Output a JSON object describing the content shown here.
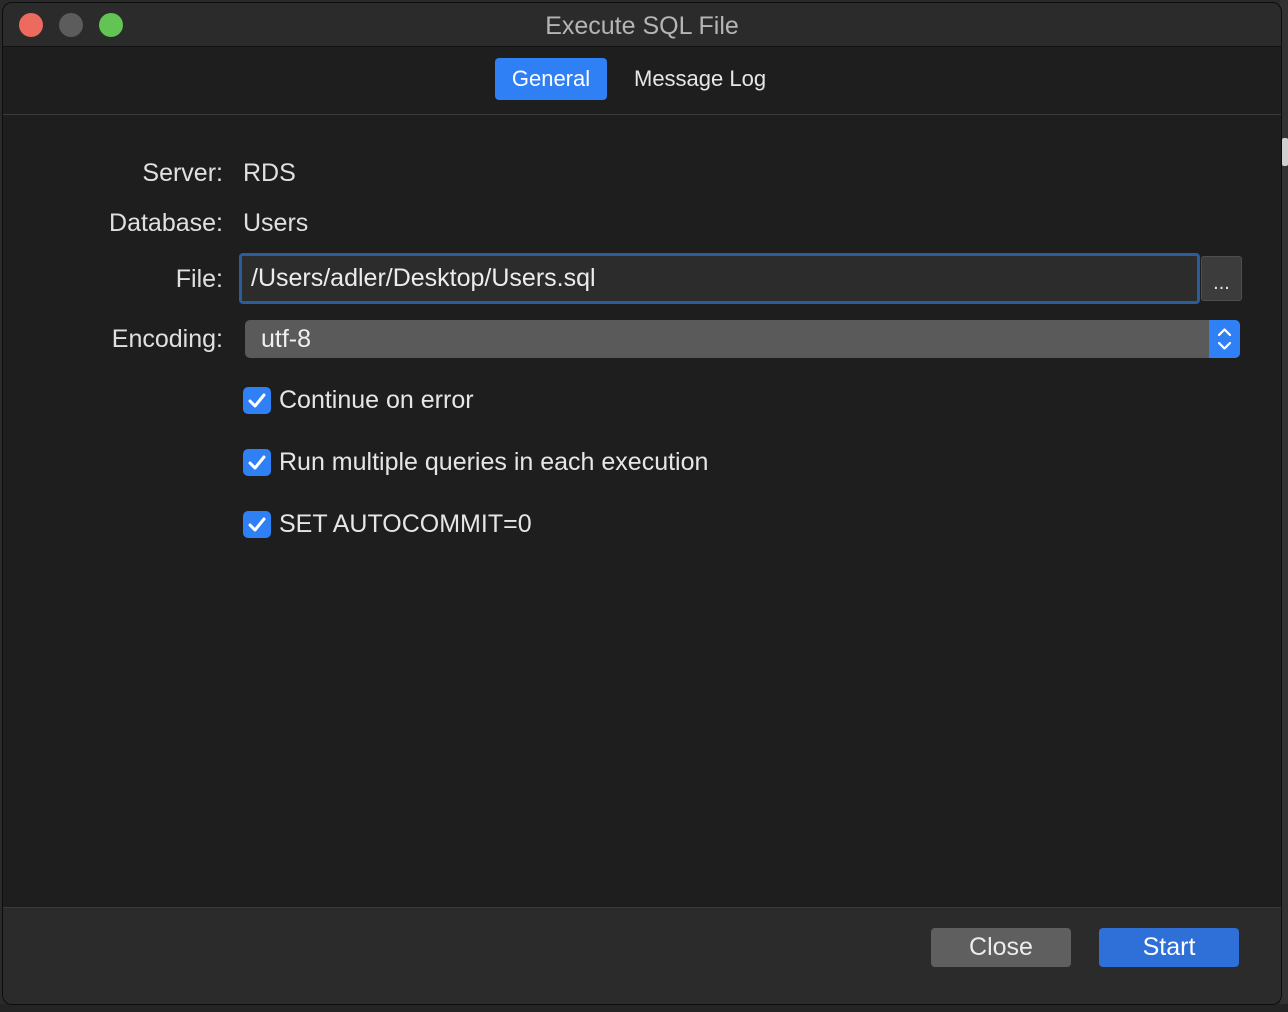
{
  "window": {
    "title": "Execute SQL File"
  },
  "tabs": [
    {
      "label": "General",
      "selected": true
    },
    {
      "label": "Message Log",
      "selected": false
    }
  ],
  "form": {
    "server_label": "Server:",
    "server_value": "RDS",
    "database_label": "Database:",
    "database_value": "Users",
    "file_label": "File:",
    "file_value": "/Users/adler/Desktop/Users.sql",
    "browse_label": "...",
    "encoding_label": "Encoding:",
    "encoding_value": "utf-8"
  },
  "options": [
    {
      "label": "Continue on error",
      "checked": true
    },
    {
      "label": "Run multiple queries in each execution",
      "checked": true
    },
    {
      "label": "SET AUTOCOMMIT=0",
      "checked": true
    }
  ],
  "buttons": {
    "close_label": "Close",
    "start_label": "Start"
  },
  "colors": {
    "accent": "#2f7ff5",
    "window_bg": "#1e1e1e",
    "focus_ring": "#2c5d9a"
  },
  "icons": [
    "checkmark-icon",
    "chevron-up-down-icon"
  ]
}
